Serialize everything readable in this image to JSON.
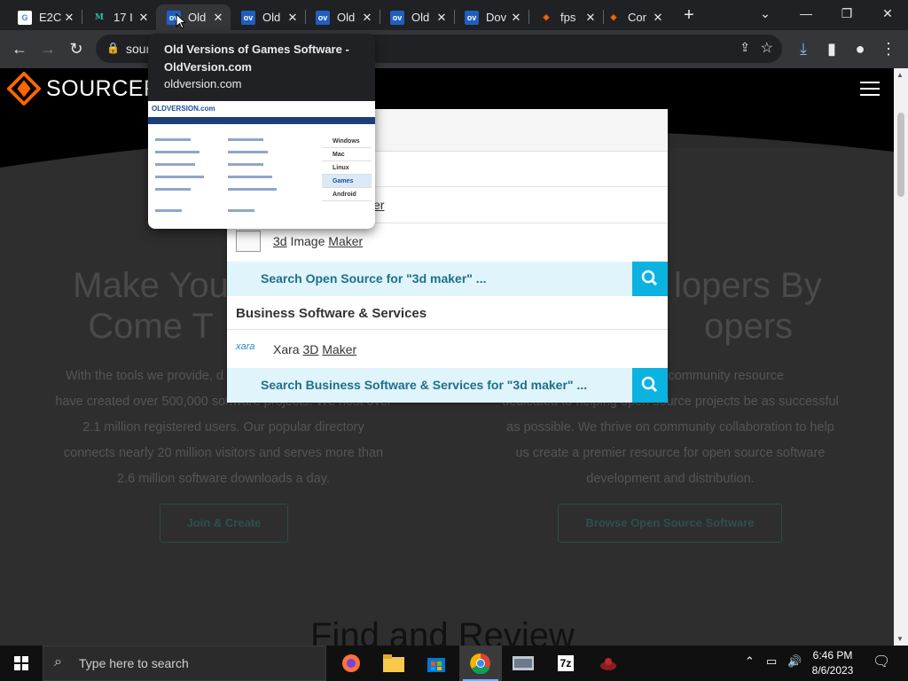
{
  "browser": {
    "tabs": [
      {
        "title": "E2C",
        "favicon": "google-icon",
        "close": "✕"
      },
      {
        "title": "17 I",
        "favicon": "m-icon",
        "close": "✕"
      },
      {
        "title": "Old",
        "favicon": "ov-icon",
        "close": "✕",
        "active": true
      },
      {
        "title": "Old",
        "favicon": "ov-icon",
        "close": "✕"
      },
      {
        "title": "Old",
        "favicon": "ov-icon",
        "close": "✕"
      },
      {
        "title": "Old",
        "favicon": "ov-icon",
        "close": "✕"
      },
      {
        "title": "Dov",
        "favicon": "ov-icon",
        "close": "✕"
      },
      {
        "title": "fps",
        "favicon": "sourceforge-icon",
        "close": "✕"
      },
      {
        "title": "Cor",
        "favicon": "sourceforge-icon",
        "close": "✕"
      }
    ],
    "favicon_label": "ov",
    "new_tab": "+",
    "address_visible": "sour",
    "hover_card": {
      "title": "Old Versions of Games Software - OldVersion.com",
      "url": "oldversion.com",
      "thumb": {
        "logo": "OLDVERSION.com",
        "side_items": [
          "Windows",
          "Mac",
          "Linux",
          "Games",
          "Android"
        ]
      }
    }
  },
  "site": {
    "logo": "SOURCEFO",
    "hero_left_title": [
      "Make You",
      "Come T"
    ],
    "hero_right_title": [
      "lopers By",
      "opers"
    ],
    "hero_left_text": [
      "With the tools we provide, d",
      "have created over 500,000 software projects. We host over",
      "2.1 million registered users. Our popular directory",
      "connects nearly 20 million visitors and serves more than",
      "2.6 million software downloads a day."
    ],
    "hero_right_text": [
      "source community resource",
      "dedicated to helping open source projects be as successful",
      "as possible. We thrive on community collaboration to help",
      "us create a premier resource for open source software",
      "development and distribution."
    ],
    "btn_join": "Join & Create",
    "btn_browse": "Browse Open Source Software",
    "find_heading": "Find and Review"
  },
  "autocomplete": {
    "row1_suffix": "ker",
    "row2_pre": "3d",
    "row2_mid": " Image ",
    "row2_post": "Maker",
    "search_os": "Search Open Source for \"3d maker\" ...",
    "category": "Business Software & Services",
    "xara_logo": "xara",
    "xara_pre": "Xara ",
    "xara_3d": "3D",
    "xara_maker": "Maker",
    "search_biz": "Search Business Software & Services for \"3d maker\" ..."
  },
  "taskbar": {
    "search_placeholder": "Type here to search",
    "time": "6:46 PM",
    "date": "8/6/2023",
    "app_7z": "7z"
  }
}
